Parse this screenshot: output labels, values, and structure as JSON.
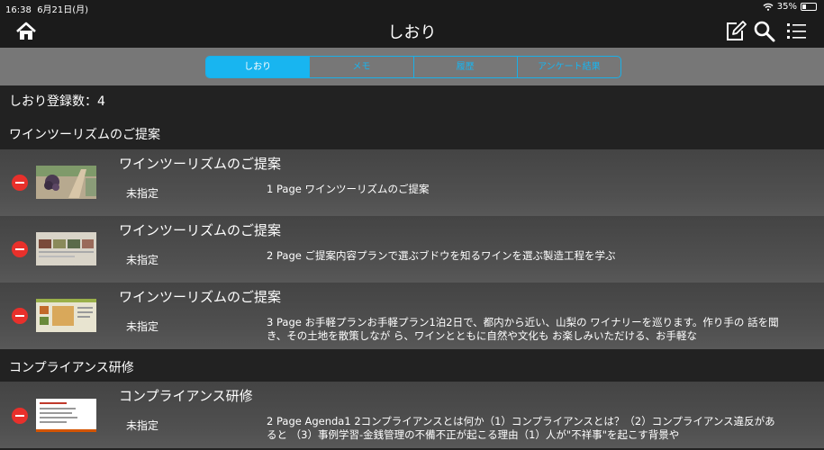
{
  "status": {
    "time": "16:38",
    "date": "6月21日(月)",
    "battery": "35%"
  },
  "nav": {
    "title": "しおり"
  },
  "tabs": [
    {
      "label": "しおり"
    },
    {
      "label": "メモ"
    },
    {
      "label": "履歴"
    },
    {
      "label": "アンケート結果"
    }
  ],
  "count_text": "しおり登録数：4",
  "groups": [
    {
      "header": "ワインツーリズムのご提案",
      "items": [
        {
          "title": "ワインツーリズムのご提案",
          "category": "未指定",
          "desc": "1 Page  ワインツーリズムのご提案"
        },
        {
          "title": "ワインツーリズムのご提案",
          "category": "未指定",
          "desc": "2 Page  ご提案内容プランで選ぶブドウを知るワインを選ぶ製造工程を学ぶ"
        },
        {
          "title": "ワインツーリズムのご提案",
          "category": "未指定",
          "desc": "3 Page  お手軽プランお手軽プラン1泊2日で、都内から近い、山梨の ワイナリーを巡ります。作り手の 話を聞き、その土地を散策しなが ら、ワインとともに自然や文化も お楽しみいただける、お手軽な"
        }
      ]
    },
    {
      "header": "コンプライアンス研修",
      "items": [
        {
          "title": "コンプライアンス研修",
          "category": "未指定",
          "desc": "2 Page  Agenda1 2コンプライアンスとは何か（1）コンプライアンスとは？（2）コンプライアンス違反があると （3）事例学習-金銭管理の不備不正が起こる理由（1）人が\"不祥事\"を起こす背景や"
        }
      ]
    }
  ]
}
